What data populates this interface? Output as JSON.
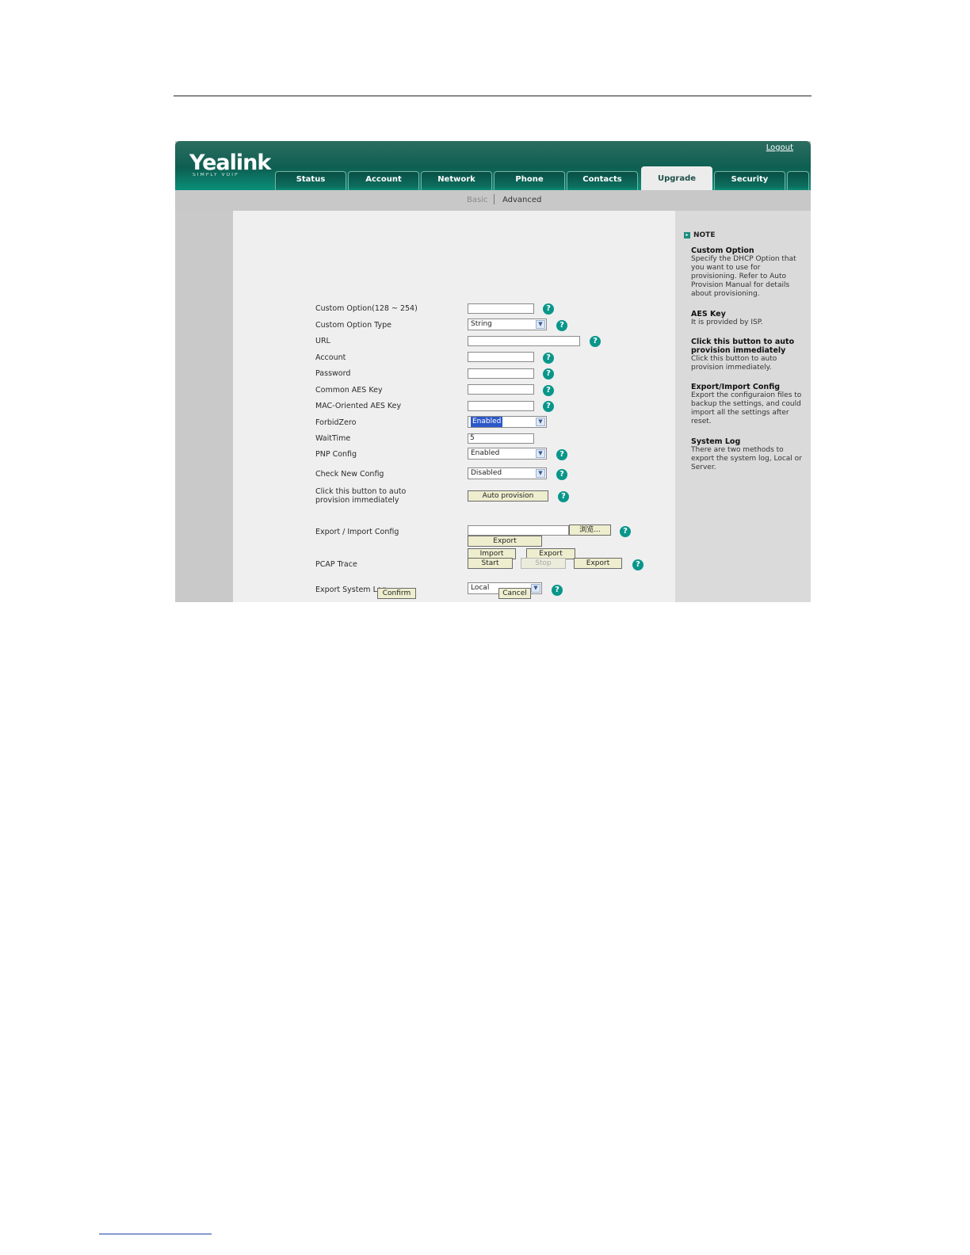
{
  "brand": {
    "name": "Yealink",
    "tagline": "SIMPLY VOIP"
  },
  "header": {
    "logout": "Logout"
  },
  "tabs": [
    {
      "label": "Status"
    },
    {
      "label": "Account"
    },
    {
      "label": "Network"
    },
    {
      "label": "Phone"
    },
    {
      "label": "Contacts"
    },
    {
      "label": "Upgrade",
      "active": true
    },
    {
      "label": "Security"
    }
  ],
  "subnav": {
    "basic": "Basic",
    "advanced": "Advanced"
  },
  "form": {
    "custom_option": {
      "label": "Custom Option(128 ~ 254)",
      "value": ""
    },
    "custom_option_type": {
      "label": "Custom Option Type",
      "value": "String"
    },
    "url": {
      "label": "URL",
      "value": ""
    },
    "account": {
      "label": "Account",
      "value": ""
    },
    "password": {
      "label": "Password",
      "value": ""
    },
    "common_aes_key": {
      "label": "Common AES Key",
      "value": ""
    },
    "mac_aes_key": {
      "label": "MAC-Oriented AES Key",
      "value": ""
    },
    "forbidzero": {
      "label": "ForbidZero",
      "value": "Enabled"
    },
    "waittime": {
      "label": "WaitTime",
      "value": "5"
    },
    "pnp_config": {
      "label": "PNP Config",
      "value": "Enabled"
    },
    "check_new_config": {
      "label": "Check New Config",
      "value": "Disabled"
    },
    "auto_provision": {
      "label": "Click this button to auto provision immediately",
      "button": "Auto provision"
    },
    "export_import": {
      "label": "Export / Import Config",
      "value": "",
      "browse": "浏览...",
      "import": "Import",
      "export": "Export"
    },
    "export_log": {
      "label": "Export System Log",
      "value": "Local",
      "export": "Export"
    },
    "pcap": {
      "label": "PCAP Trace",
      "start": "Start",
      "stop": "Stop",
      "export": "Export"
    },
    "confirm": "Confirm",
    "cancel": "Cancel"
  },
  "note": {
    "title": "NOTE",
    "items": [
      {
        "heading": "Custom Option",
        "text": "Specify the DHCP Option that you want to use for provisioning. Refer to Auto Provision Manual for details about provisioning."
      },
      {
        "heading": "AES Key",
        "text": "It is provided by ISP."
      },
      {
        "heading": "Click this button to auto provision immediately",
        "text": "Click this button to auto provision immediately."
      },
      {
        "heading": "Export/Import Config",
        "text": "Export the configuraion files to backup the settings, and could import all the settings after reset."
      },
      {
        "heading": "System Log",
        "text": "There are two methods to export the system log, Local or Server."
      }
    ]
  },
  "icons": {
    "help": "help-icon",
    "dropdown": "chevron-down-icon",
    "note": "note-icon"
  },
  "colors": {
    "accent": "#0d5f52",
    "help": "#08968a"
  }
}
